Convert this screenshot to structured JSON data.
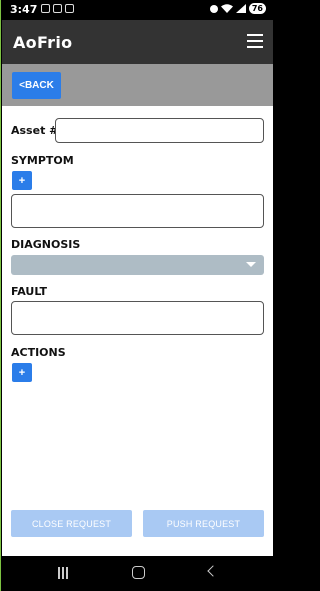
{
  "status_bar": {
    "time": "3:47",
    "battery": "76"
  },
  "app": {
    "logo": "AoFrio"
  },
  "nav": {
    "back_label": "<BACK"
  },
  "form": {
    "asset_label": "Asset #",
    "asset_value": "",
    "symptom_label": "SYMPTOM",
    "symptom_add": "+",
    "symptom_value": "",
    "diagnosis_label": "DIAGNOSIS",
    "diagnosis_selected": "",
    "fault_label": "FAULT",
    "fault_value": "",
    "actions_label": "ACTIONS",
    "actions_add": "+"
  },
  "footer": {
    "close_label": "CLOSE REQUEST",
    "push_label": "PUSH REQUEST"
  },
  "colors": {
    "accent": "#2b7de9",
    "header": "#333333",
    "band": "#999999",
    "disabled": "#a9c9f3"
  }
}
